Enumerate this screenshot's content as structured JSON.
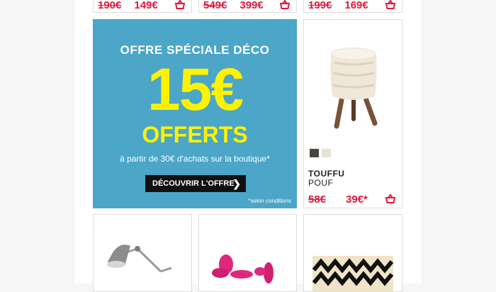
{
  "top_row": [
    {
      "old_price": "190€",
      "new_price": "149€"
    },
    {
      "old_price": "549€",
      "new_price": "399€"
    },
    {
      "old_price": "199€",
      "new_price": "169€"
    }
  ],
  "banner": {
    "title": "OFFRE SPÉCIALE DÉCO",
    "amount": "15€",
    "offer": "OFFERTS",
    "subtitle": "à partir de 30€ d'achats sur la boutique*",
    "button_label": "DÉCOUVRIR L'OFFRE",
    "conditions": "*selon conditions"
  },
  "product_pouf": {
    "name": "TOUFFU",
    "type": "POUF",
    "old_price": "58€",
    "new_price": "39€*",
    "swatches": [
      "#4a4541",
      "#e8e2d6"
    ]
  },
  "colors": {
    "accent_red": "#e3173b",
    "banner_blue": "#4ba6c8",
    "banner_yellow": "#fff200"
  },
  "icons": {
    "cart": "shopping-basket-icon",
    "chevron": "chevron-right-icon"
  }
}
